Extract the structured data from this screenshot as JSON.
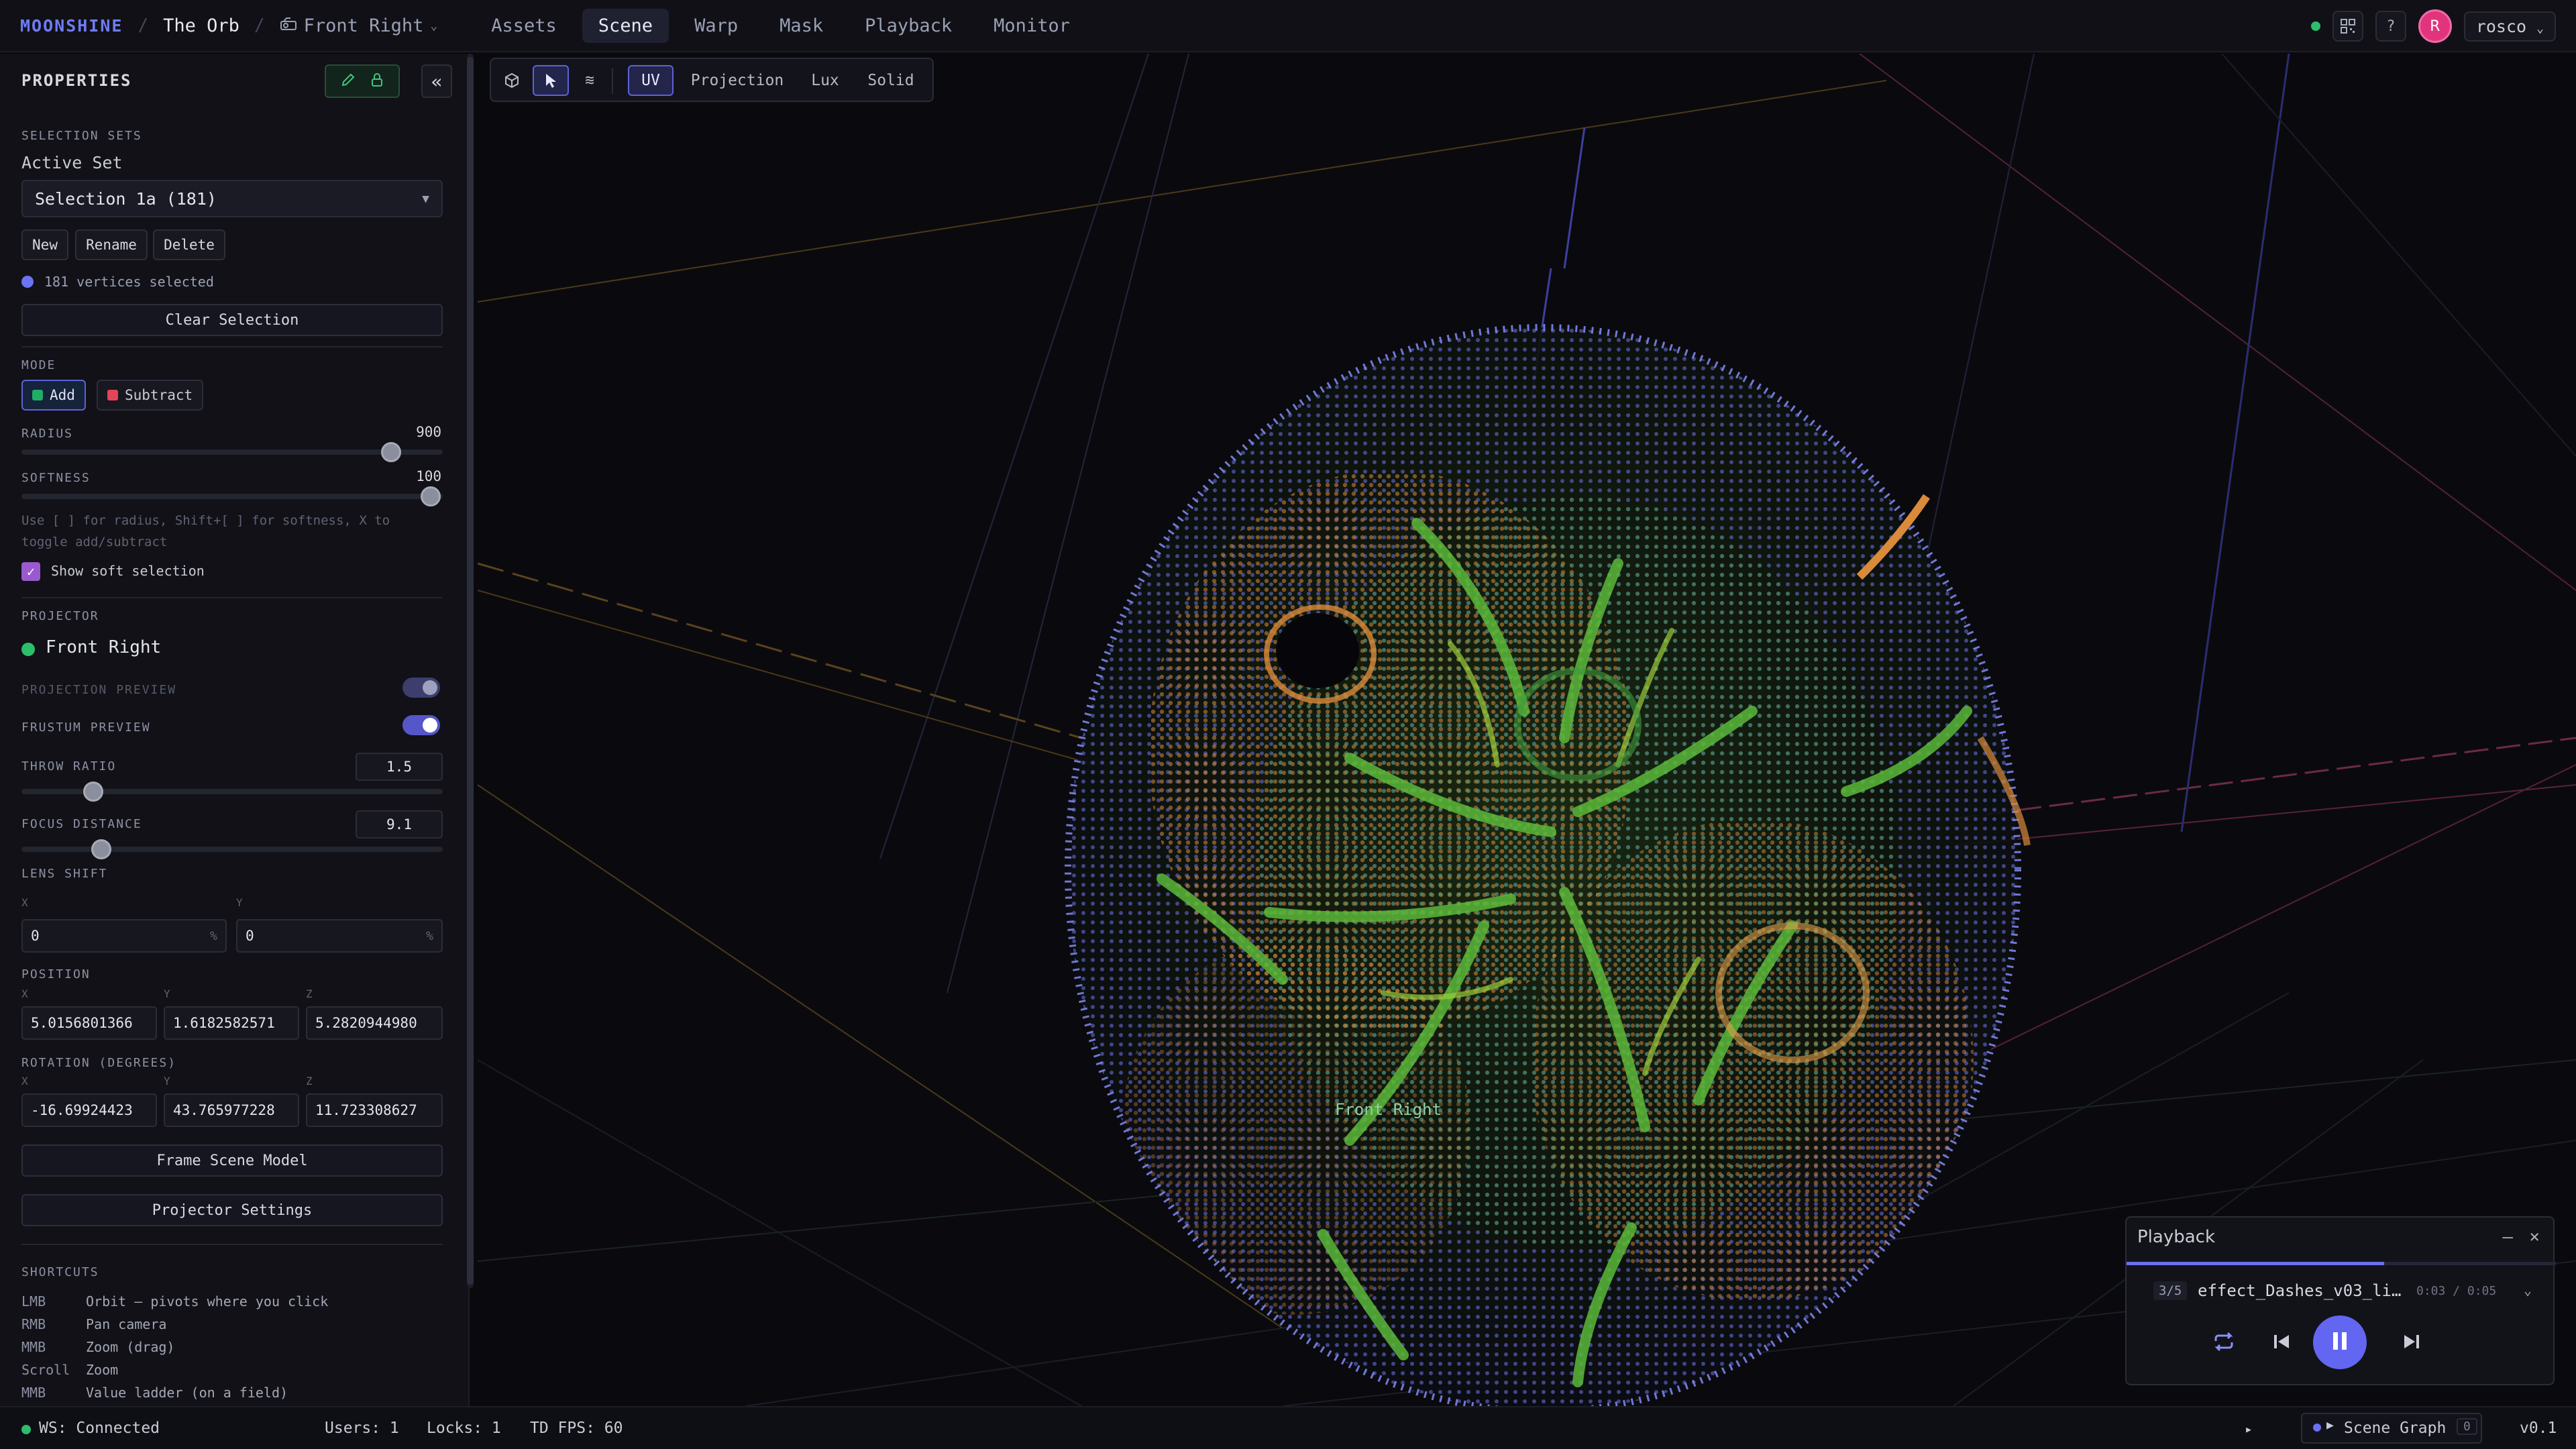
{
  "topbar": {
    "brand": "MOONSHINE",
    "project": "The Orb",
    "camera": "Front Right",
    "tabs": [
      "Assets",
      "Scene",
      "Warp",
      "Mask",
      "Playback",
      "Monitor"
    ],
    "active_tab": "Scene",
    "user": "rosco",
    "avatar_initial": "R",
    "help": "?"
  },
  "panel": {
    "title": "PROPERTIES",
    "selection_sets": {
      "section": "SELECTION SETS",
      "active_label": "Active Set",
      "active_value": "Selection 1a (181)",
      "new": "New",
      "rename": "Rename",
      "delete": "Delete",
      "status": "181 vertices selected",
      "clear": "Clear Selection"
    },
    "mode": {
      "section": "MODE",
      "add": "Add",
      "subtract": "Subtract",
      "radius_label": "RADIUS",
      "radius_value": "900",
      "radius_level": 0.9,
      "softness_label": "SOFTNESS",
      "softness_value": "100",
      "softness_level": 1.0,
      "hint": "Use [ ] for radius, Shift+[ ] for softness, X to toggle add/subtract",
      "show_soft": "Show soft selection"
    },
    "projector": {
      "section": "PROJECTOR",
      "name": "Front Right",
      "projection_preview": "PROJECTION PREVIEW",
      "frustum_preview": "FRUSTUM PREVIEW",
      "throw_ratio_label": "THROW RATIO",
      "throw_ratio": "1.5",
      "focus_distance_label": "FOCUS DISTANCE",
      "focus_distance": "9.1",
      "lens_shift_label": "LENS SHIFT",
      "lens_x": "0",
      "lens_y": "0",
      "percent": "%",
      "position_label": "POSITION",
      "pos_x": "5.0156801366",
      "pos_y": "1.6182582571",
      "pos_z": "5.2820944980",
      "rotation_label": "ROTATION (DEGREES)",
      "rot_x": "-16.69924423",
      "rot_y": "43.765977228",
      "rot_z": "11.723308627",
      "axis_x": "X",
      "axis_y": "Y",
      "axis_z": "Z",
      "frame_scene": "Frame Scene Model",
      "projector_settings": "Projector Settings"
    },
    "shortcuts": {
      "section": "SHORTCUTS",
      "items": [
        {
          "key": "LMB",
          "desc": "Orbit — pivots where you click"
        },
        {
          "key": "RMB",
          "desc": "Pan camera"
        },
        {
          "key": "MMB",
          "desc": "Zoom (drag)"
        },
        {
          "key": "Scroll",
          "desc": "Zoom"
        },
        {
          "key": "MMB",
          "desc": "Value ladder (on a field)"
        }
      ]
    }
  },
  "viewport": {
    "toolbar": [
      "UV",
      "Projection",
      "Lux",
      "Solid"
    ],
    "active_view": "UV",
    "projector_label": "Front Right"
  },
  "playback": {
    "title": "Playback",
    "counter": "3/5",
    "clip": "effect_Dashes_v03_li…",
    "time": "0:03 / 0:05",
    "progress": 0.6
  },
  "status": {
    "ws": "WS: Connected",
    "users": "Users: 1",
    "locks": "Locks: 1",
    "fps": "TD FPS: 60",
    "scene_graph": "Scene Graph",
    "scene_graph_count": "0",
    "version": "v0.1"
  },
  "colors": {
    "accent": "#6366f1",
    "connected": "#2dbe6c",
    "add": "#1fae66",
    "subtract": "#e24558",
    "avatar": "#e1347d"
  }
}
